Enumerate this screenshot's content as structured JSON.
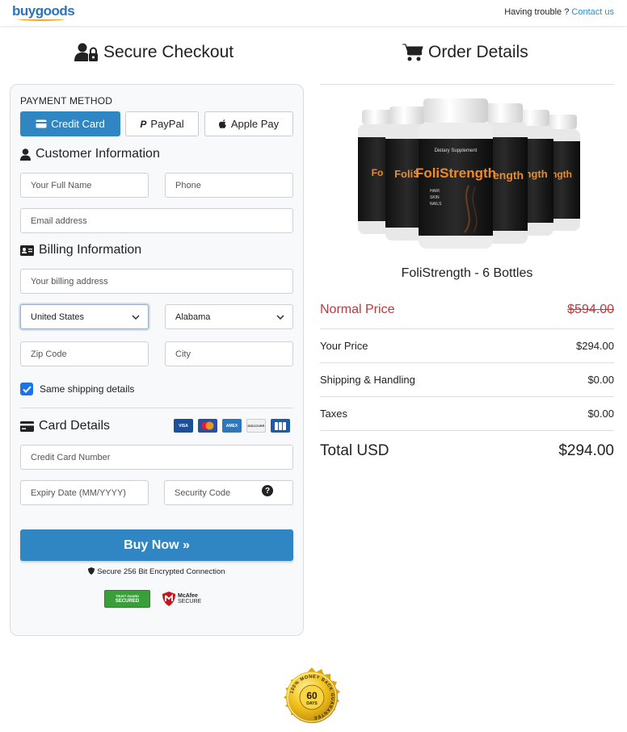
{
  "header": {
    "logo": "buygoods",
    "trouble_text": "Having trouble ?",
    "contact_link": "Contact us"
  },
  "checkout": {
    "title": "Secure Checkout",
    "payment_method_label": "PAYMENT METHOD",
    "payment_methods": [
      {
        "label": "Credit Card",
        "icon": "credit-card-icon",
        "active": true
      },
      {
        "label": "PayPal",
        "icon": "paypal-icon",
        "active": false
      },
      {
        "label": "Apple Pay",
        "icon": "apple-icon",
        "active": false
      }
    ],
    "customer_heading": "Customer Information",
    "full_name_placeholder": "Your Full Name",
    "phone_placeholder": "Phone",
    "email_placeholder": "Email address",
    "billing_heading": "Billing Information",
    "billing_address_placeholder": "Your billing address",
    "country_value": "United States",
    "state_value": "Alabama",
    "zip_placeholder": "Zip Code",
    "city_placeholder": "City",
    "same_shipping_label": "Same shipping details",
    "same_shipping_checked": true,
    "card_heading": "Card Details",
    "card_brands": [
      "VISA",
      "MC",
      "AMEX",
      "DISCOVER",
      "JCB"
    ],
    "card_number_placeholder": "Credit Card Number",
    "expiry_placeholder": "Expiry Date (MM/YYYY)",
    "security_code_placeholder": "Security Code",
    "buy_button": "Buy Now »",
    "secure_text": "Secure 256 Bit Encrypted Connection",
    "trust_secured_top": "TRUST GUARD",
    "trust_secured": "SECURED",
    "mcafee_line1": "McAfee",
    "mcafee_line2": "SECURE"
  },
  "order": {
    "title": "Order Details",
    "product_name": "FoliStrength - 6 Bottles",
    "bottle_brand": "FoliStrength",
    "bottle_supplement": "Dietary Supplement",
    "bottle_lines": [
      "HAIR",
      "SKIN",
      "NAILS"
    ],
    "normal_price_label": "Normal Price",
    "normal_price_value": "$594.00",
    "your_price_label": "Your Price",
    "your_price_value": "$294.00",
    "shipping_label": "Shipping & Handling",
    "shipping_value": "$0.00",
    "taxes_label": "Taxes",
    "taxes_value": "$0.00",
    "total_label": "Total USD",
    "total_value": "$294.00"
  },
  "guarantee": {
    "ring_text": "100% MONEY BACK GUARANTEE",
    "number": "60",
    "unit": "DAYS"
  },
  "colors": {
    "accent": "#2f86c2",
    "link": "#2a8fc4",
    "normal_price": "#c9343a",
    "checkbox": "#1a73e8"
  }
}
